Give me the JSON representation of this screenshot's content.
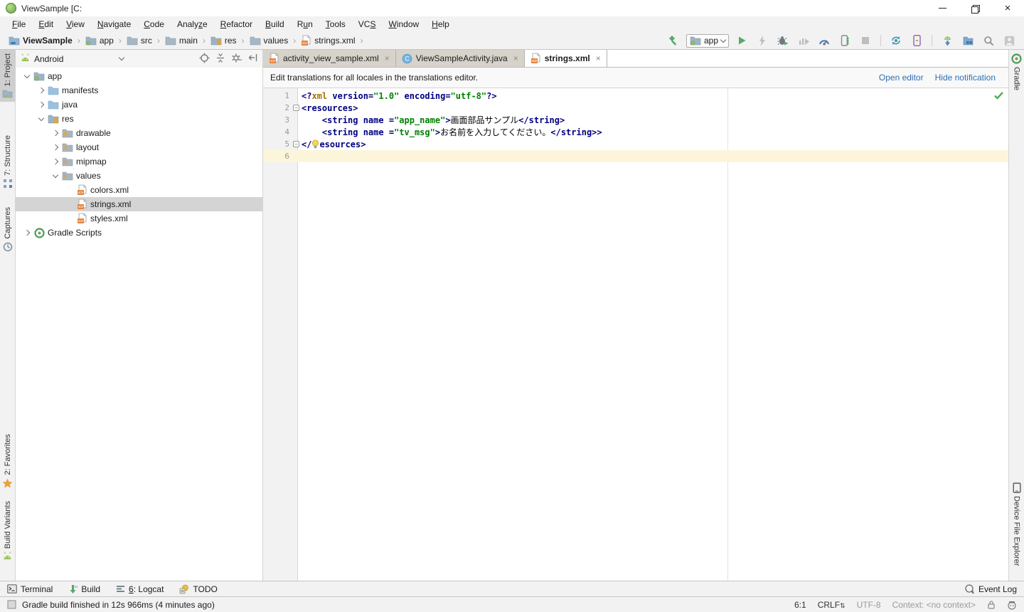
{
  "window": {
    "title": "ViewSample [C:"
  },
  "menu": {
    "items": [
      {
        "label": "File",
        "u": 0
      },
      {
        "label": "Edit",
        "u": 0
      },
      {
        "label": "View",
        "u": 0
      },
      {
        "label": "Navigate",
        "u": 0
      },
      {
        "label": "Code",
        "u": 0
      },
      {
        "label": "Analyze",
        "u": 5
      },
      {
        "label": "Refactor",
        "u": 0
      },
      {
        "label": "Build",
        "u": 0
      },
      {
        "label": "Run",
        "u": 1
      },
      {
        "label": "Tools",
        "u": 0
      },
      {
        "label": "VCS",
        "u": 2
      },
      {
        "label": "Window",
        "u": 0
      },
      {
        "label": "Help",
        "u": 0
      }
    ]
  },
  "toolbar": {
    "breadcrumbs": [
      {
        "icon": "project",
        "label": "ViewSample"
      },
      {
        "icon": "folder-app",
        "label": "app"
      },
      {
        "icon": "folder",
        "label": "src"
      },
      {
        "icon": "folder",
        "label": "main"
      },
      {
        "icon": "folder-res",
        "label": "res"
      },
      {
        "icon": "folder",
        "label": "values"
      },
      {
        "icon": "xmlfile",
        "label": "strings.xml"
      }
    ],
    "run_config": {
      "label": "app"
    },
    "actions": [
      {
        "icon": "hammer",
        "name": "make-project"
      },
      {
        "type": "runconfig"
      },
      {
        "icon": "run",
        "name": "run"
      },
      {
        "icon": "lightning",
        "name": "apply-changes",
        "disabled": true
      },
      {
        "icon": "bug",
        "name": "debug"
      },
      {
        "icon": "profile",
        "name": "profile",
        "disabled": true
      },
      {
        "icon": "gauge",
        "name": "android-profiler"
      },
      {
        "icon": "attach",
        "name": "attach-debugger"
      },
      {
        "icon": "stop",
        "name": "stop",
        "disabled": true
      },
      {
        "type": "sep"
      },
      {
        "icon": "sync",
        "name": "gradle-sync"
      },
      {
        "icon": "phone",
        "name": "avd-manager"
      },
      {
        "type": "sep"
      },
      {
        "icon": "sdk",
        "name": "sdk-manager"
      },
      {
        "icon": "layout",
        "name": "project-structure"
      },
      {
        "icon": "search",
        "name": "search-everywhere"
      },
      {
        "icon": "avatar",
        "name": "profile-account"
      }
    ]
  },
  "left_stripe": {
    "top": [
      {
        "icon": "project-tw",
        "label": "1: Project",
        "active": true,
        "mt": 0
      },
      {
        "icon": "structure",
        "label": "7: Structure",
        "mt": 42
      },
      {
        "icon": "captures",
        "label": "Captures",
        "mt": 16
      }
    ],
    "bottom": [
      {
        "icon": "favorites",
        "label": "2: Favorites",
        "mb": 8
      },
      {
        "icon": "android",
        "label": "Build Variants",
        "mb": 24
      }
    ]
  },
  "right_stripe": {
    "top": [
      {
        "icon": "gradle",
        "label": "Gradle",
        "mt": 0
      }
    ],
    "bottom": [
      {
        "icon": "device",
        "label": "Device File Explorer",
        "mb": 16
      }
    ]
  },
  "project_panel": {
    "selector": {
      "icon": "android",
      "label": "Android"
    },
    "tree": [
      {
        "depth": 0,
        "chevron": "down",
        "icon": "folder-app",
        "label": "app"
      },
      {
        "depth": 1,
        "chevron": "right",
        "icon": "folder-blue",
        "label": "manifests"
      },
      {
        "depth": 1,
        "chevron": "right",
        "icon": "folder-blue",
        "label": "java"
      },
      {
        "depth": 1,
        "chevron": "down",
        "icon": "folder-res",
        "label": "res"
      },
      {
        "depth": 2,
        "chevron": "right",
        "icon": "folder-sub",
        "label": "drawable"
      },
      {
        "depth": 2,
        "chevron": "right",
        "icon": "folder-sub",
        "label": "layout"
      },
      {
        "depth": 2,
        "chevron": "right",
        "icon": "folder-sub",
        "label": "mipmap"
      },
      {
        "depth": 2,
        "chevron": "down",
        "icon": "folder-sub",
        "label": "values"
      },
      {
        "depth": 3,
        "chevron": "none",
        "icon": "xmlfile",
        "label": "colors.xml"
      },
      {
        "depth": 3,
        "chevron": "none",
        "icon": "xmlfile",
        "label": "strings.xml",
        "selected": true
      },
      {
        "depth": 3,
        "chevron": "none",
        "icon": "xmlfile",
        "label": "styles.xml"
      },
      {
        "depth": 0,
        "chevron": "right",
        "icon": "gradle",
        "label": "Gradle Scripts"
      }
    ]
  },
  "editor": {
    "tabs": [
      {
        "icon": "xmlfile",
        "label": "activity_view_sample.xml"
      },
      {
        "icon": "class",
        "label": "ViewSampleActivity.java"
      },
      {
        "icon": "xmlfile",
        "label": "strings.xml",
        "active": true
      }
    ],
    "notification": {
      "text": "Edit translations for all locales in the translations editor.",
      "links": [
        {
          "label": "Open editor"
        },
        {
          "label": "Hide notification"
        }
      ]
    },
    "code": {
      "caret_line": 6,
      "lines": [
        {
          "n": 1,
          "tokens": [
            [
              "k",
              "<?"
            ],
            [
              "p",
              "xml"
            ],
            [
              "k",
              " version="
            ],
            [
              "v",
              "\"1.0\""
            ],
            [
              "k",
              " encoding="
            ],
            [
              "v",
              "\"utf-8\""
            ],
            [
              "k",
              "?>"
            ]
          ]
        },
        {
          "n": 2,
          "fold": "open",
          "tokens": [
            [
              "k",
              "<resources>"
            ]
          ]
        },
        {
          "n": 3,
          "tokens": [
            [
              "t",
              "    "
            ],
            [
              "k",
              "<string name ="
            ],
            [
              "v",
              "\"app_name\""
            ],
            [
              "k",
              ">"
            ],
            [
              "t",
              "画面部品サンプル"
            ],
            [
              "k",
              "</string>"
            ]
          ]
        },
        {
          "n": 4,
          "tokens": [
            [
              "t",
              "    "
            ],
            [
              "k",
              "<string name ="
            ],
            [
              "v",
              "\"tv_msg\""
            ],
            [
              "k",
              ">"
            ],
            [
              "t",
              "お名前を入力してください。"
            ],
            [
              "k",
              "</string>>"
            ]
          ]
        },
        {
          "n": 5,
          "fold": "close",
          "tokens": [
            [
              "k",
              "</"
            ],
            [
              "b",
              ""
            ],
            [
              "k",
              "esources>"
            ]
          ]
        },
        {
          "n": 6,
          "tokens": []
        }
      ]
    }
  },
  "bottom_bar": {
    "left": [
      {
        "icon": "terminal",
        "label": "Terminal"
      },
      {
        "icon": "build",
        "label": "Build"
      },
      {
        "icon": "logcat",
        "label": "6: Logcat",
        "u": 0
      },
      {
        "icon": "todo",
        "label": "TODO"
      }
    ],
    "right": [
      {
        "icon": "eventlog",
        "label": "Event Log"
      }
    ]
  },
  "status_bar": {
    "message": "Gradle build finished in 12s 966ms (4 minutes ago)",
    "caret": "6:1",
    "line_ending": "CRLF",
    "encoding": "UTF-8",
    "context": "Context: <no context>"
  },
  "colors": {
    "accent_green": "#59a869",
    "link_blue": "#2e6fb5",
    "selection_gray": "#d4d4d4",
    "caret_line_bg": "#fcf5da",
    "xml_tag": "#000080",
    "xml_value": "#008000",
    "xml_prolog": "#a66f00"
  }
}
